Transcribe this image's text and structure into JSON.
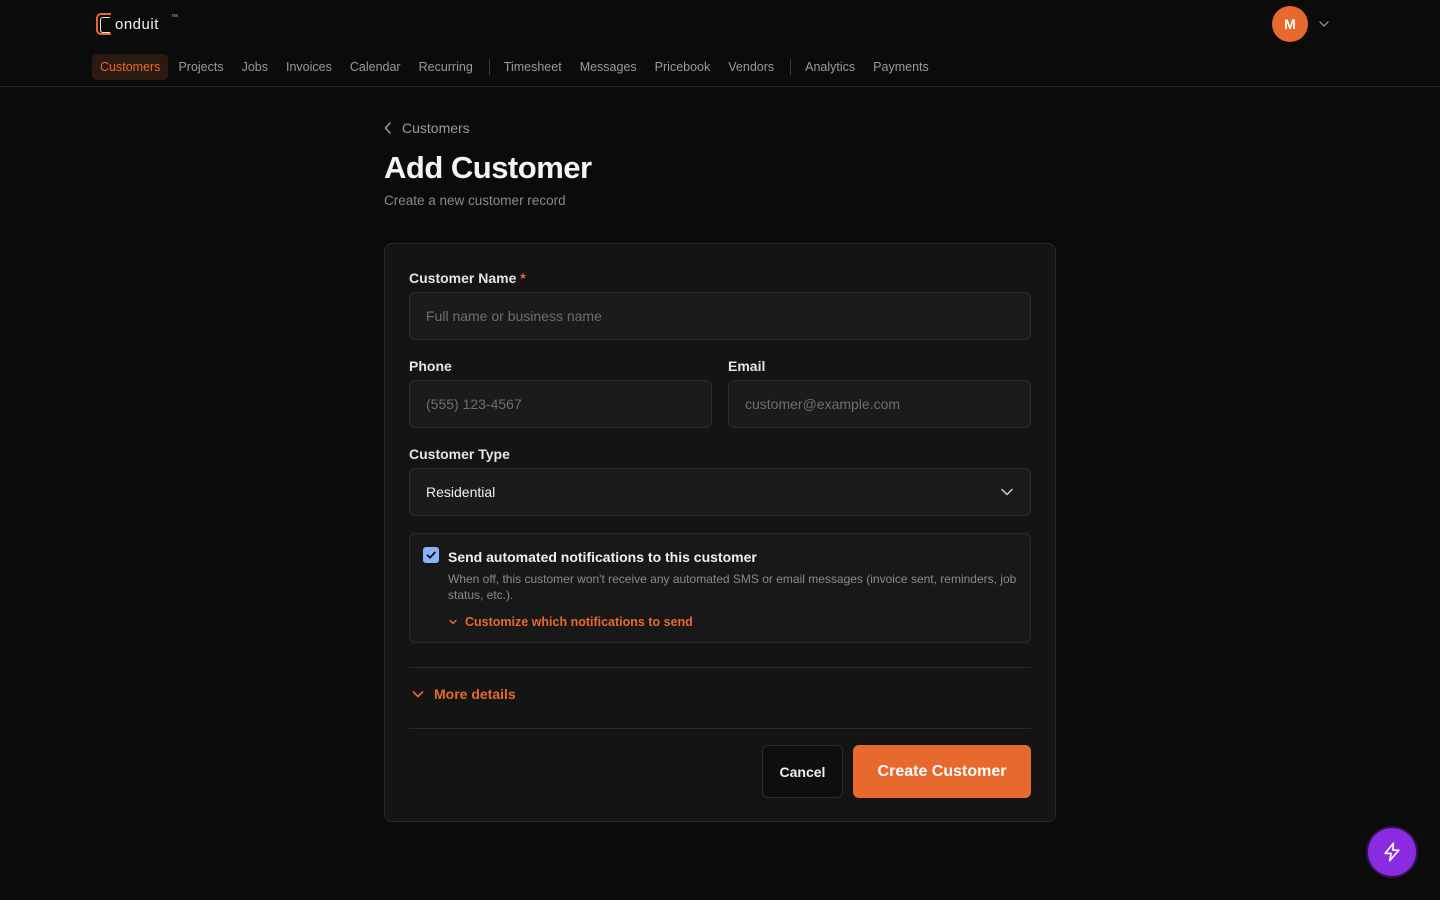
{
  "app": {
    "logo_text": "onduit",
    "logo_tm": "™",
    "user_initial": "M"
  },
  "nav": {
    "items": [
      "Customers",
      "Projects",
      "Jobs",
      "Invoices",
      "Calendar",
      "Recurring",
      "Timesheet",
      "Messages",
      "Pricebook",
      "Vendors",
      "Analytics",
      "Payments"
    ],
    "active": "Customers"
  },
  "breadcrumb": {
    "back_label": "Customers"
  },
  "page": {
    "title": "Add Customer",
    "subtitle": "Create a new customer record"
  },
  "form": {
    "name_label": "Customer Name",
    "required_mark": "*",
    "name_placeholder": "Full name or business name",
    "name_value": "",
    "phone_label": "Phone",
    "phone_placeholder": "(555) 123-4567",
    "phone_value": "",
    "email_label": "Email",
    "email_placeholder": "customer@example.com",
    "email_value": "",
    "type_label": "Customer Type",
    "type_value": "Residential",
    "notify_checked": true,
    "notify_title": "Send automated notifications to this customer",
    "notify_desc": "When off, this customer won't receive any automated SMS or email messages (invoice sent, reminders, job status, etc.).",
    "notify_customize": "Customize which notifications to send",
    "more_details": "More details",
    "cancel_label": "Cancel",
    "submit_label": "Create Customer"
  },
  "colors": {
    "accent": "#e8692d",
    "fab": "#8a2be2",
    "checkbox": "#8ab4f8"
  },
  "icons": {
    "back": "chevron-left-icon",
    "select": "chevron-down-icon",
    "fab": "lightning-icon"
  }
}
